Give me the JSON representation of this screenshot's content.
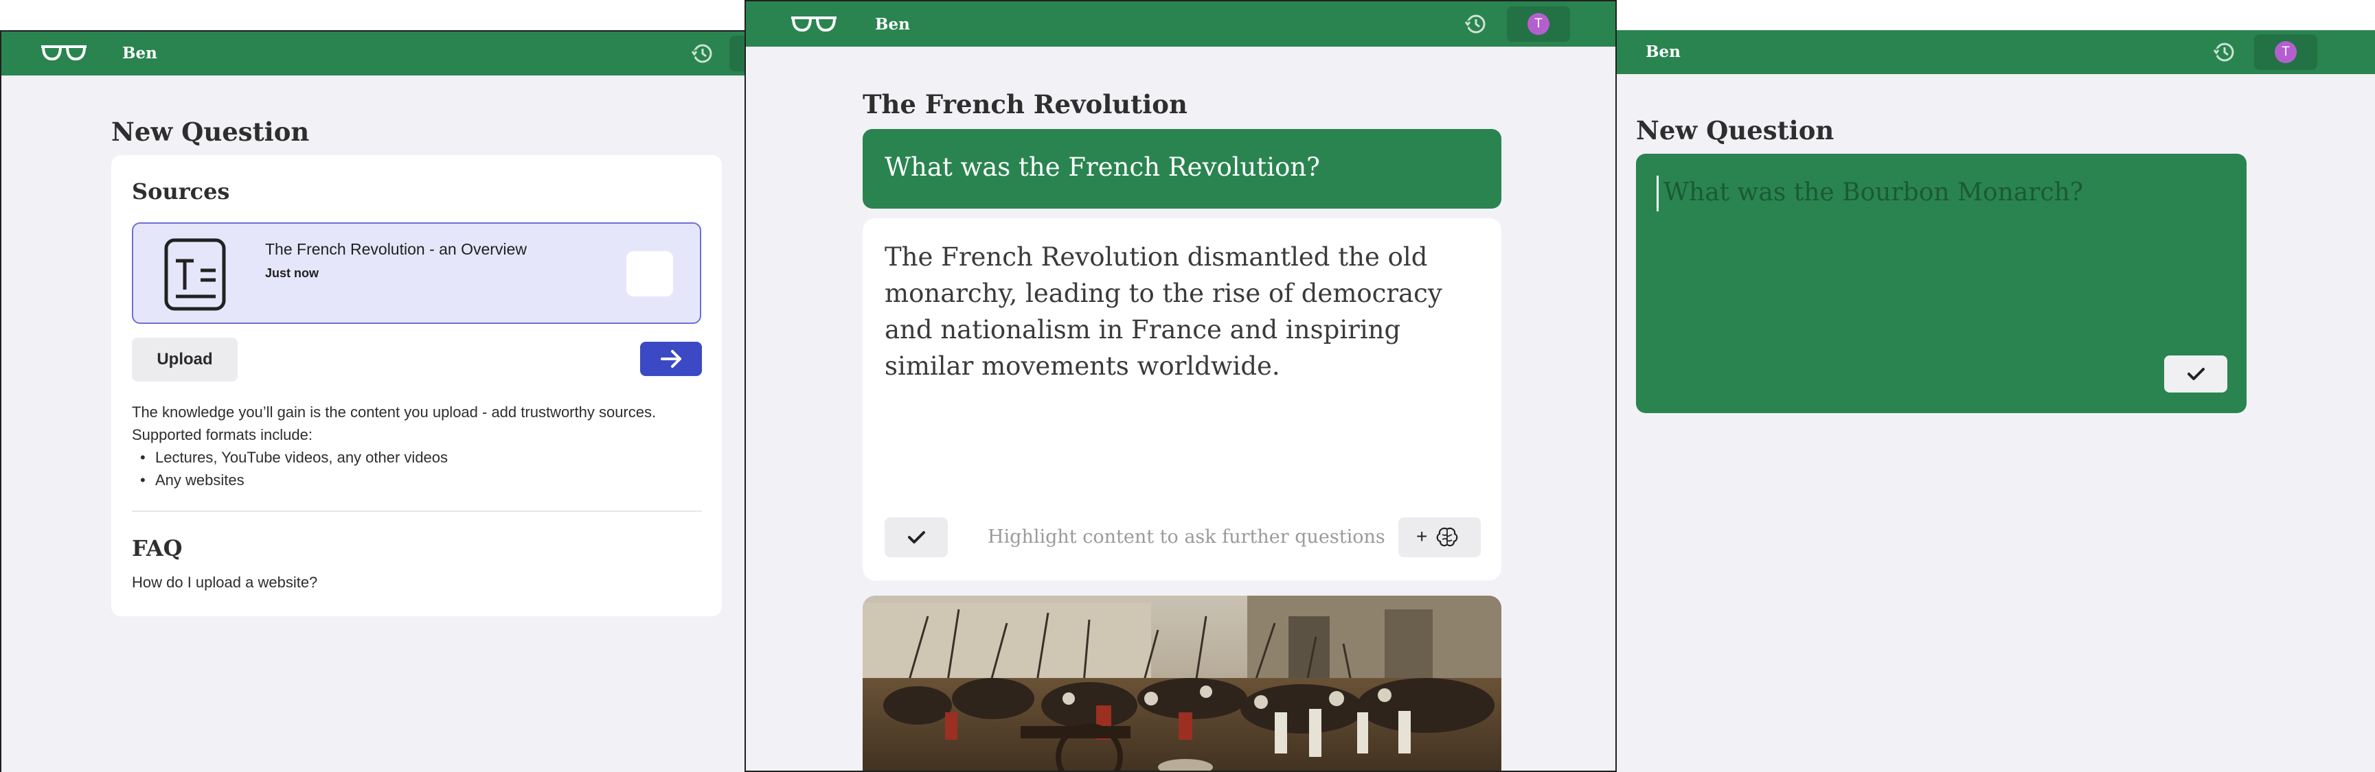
{
  "left": {
    "brand": "Ben",
    "page_title": "New Question",
    "sources_title": "Sources",
    "source": {
      "title": "The French Revolution - an Overview",
      "time": "Just now"
    },
    "upload_label": "Upload",
    "help": "The knowledge you’ll gain is the content you upload - add trustworthy sources. Supported formats include:",
    "formats": [
      "Lectures, YouTube videos, any other videos",
      "Any websites"
    ],
    "faq_title": "FAQ",
    "faq_question": "How do I upload a website?"
  },
  "center": {
    "brand": "Ben",
    "avatar_initial": "T",
    "topic_title": "The French Revolution",
    "question": "What was the French Revolution?",
    "answer": "The French Revolution dismantled the old monarchy, leading to the rise of democracy and nationalism in France and inspiring similar movements worldwide.",
    "hint": "Highlight content to ask further questions",
    "add_label": "+"
  },
  "right": {
    "brand": "Ben",
    "avatar_initial": "T",
    "page_title": "New Question",
    "input_value": "What was the Bourbon Monarch?"
  },
  "colors": {
    "brand_green": "#2a8450",
    "accent_blue": "#3b49c4",
    "avatar_purple": "#b55fcf",
    "panel_bg": "#f2f1f6"
  },
  "icons": [
    "glasses-icon",
    "history-icon",
    "document-icon",
    "arrow-right-icon",
    "check-icon",
    "brain-icon"
  ]
}
